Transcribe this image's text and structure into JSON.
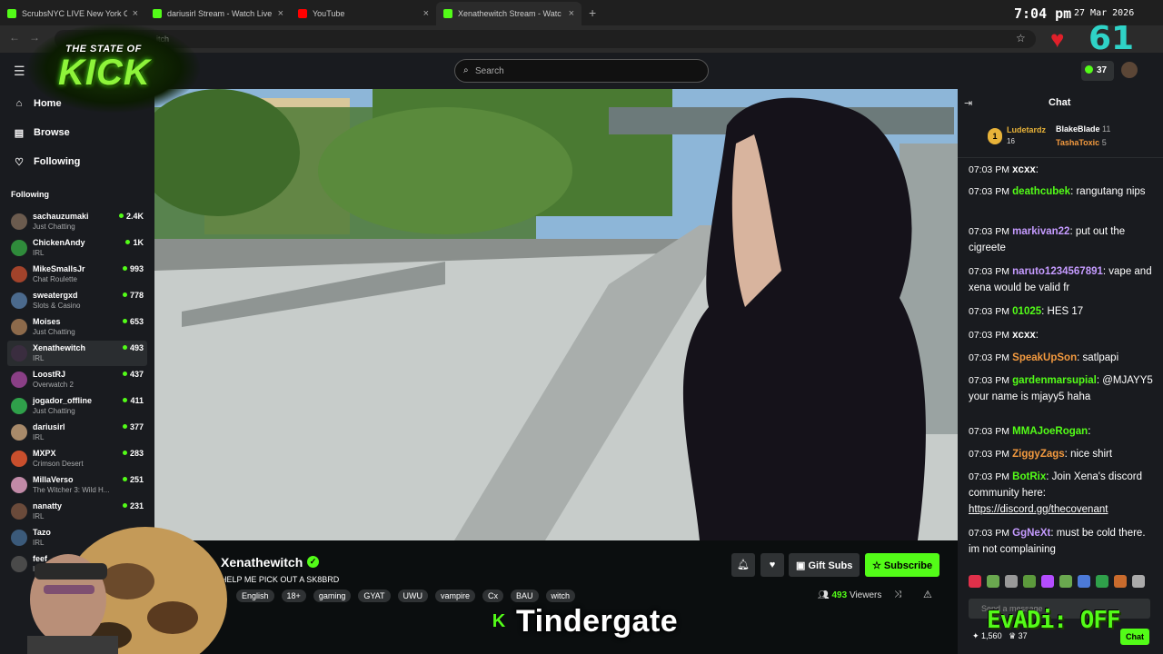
{
  "tabs": [
    {
      "title": "ScrubsNYC LIVE New York C",
      "icon": "kick-icon",
      "color": "#53fc18"
    },
    {
      "title": "dariusirl Stream - Watch Live on",
      "icon": "kick-icon",
      "color": "#53fc18"
    },
    {
      "title": "YouTube",
      "icon": "youtube-icon",
      "color": "#ff0000"
    },
    {
      "title": "Xenathewitch Stream - Watc",
      "icon": "kick-icon",
      "color": "#53fc18"
    }
  ],
  "clock": {
    "time": "7:04 pm",
    "date": "27 Mar 2026"
  },
  "address": {
    "url": "kick.com/xenathewitch",
    "visible": "itch"
  },
  "overlay": {
    "heart_count": "61",
    "tindergate": "Tindergate",
    "evadi": "EvADi: OFF"
  },
  "logo": {
    "line1": "THE STATE OF",
    "line2": "KICK"
  },
  "header": {
    "search_placeholder": "Search",
    "kick_balance": "37"
  },
  "sidebar": {
    "nav": [
      {
        "label": "Home",
        "icon": "home-icon"
      },
      {
        "label": "Browse",
        "icon": "browse-icon"
      },
      {
        "label": "Following",
        "icon": "heart-icon"
      }
    ],
    "following_title": "Following",
    "channels": [
      {
        "name": "sachauzumaki",
        "category": "Just Chatting",
        "viewers": "2.4K",
        "color": "#6b5b4e"
      },
      {
        "name": "ChickenAndy",
        "category": "IRL",
        "viewers": "1K",
        "color": "#2f8b3b"
      },
      {
        "name": "MikeSmallsJr",
        "category": "Chat Roulette",
        "viewers": "993",
        "color": "#a2432b"
      },
      {
        "name": "sweatergxd",
        "category": "Slots & Casino",
        "viewers": "778",
        "color": "#4b6a8d"
      },
      {
        "name": "Moises",
        "category": "Just Chatting",
        "viewers": "653",
        "color": "#8d6a4b"
      },
      {
        "name": "Xenathewitch",
        "category": "IRL",
        "viewers": "493",
        "color": "#3a2d3f"
      },
      {
        "name": "LoostRJ",
        "category": "Overwatch 2",
        "viewers": "437",
        "color": "#8a3f86"
      },
      {
        "name": "jogador_offline",
        "category": "Just Chatting",
        "viewers": "411",
        "color": "#2fa04a"
      },
      {
        "name": "dariusirl",
        "category": "IRL",
        "viewers": "377",
        "color": "#a88a6a"
      },
      {
        "name": "MXPX",
        "category": "Crimson Desert",
        "viewers": "283",
        "color": "#c94f2d"
      },
      {
        "name": "MillaVerso",
        "category": "The Witcher 3: Wild H...",
        "viewers": "251",
        "color": "#c18aa7"
      },
      {
        "name": "nanatty",
        "category": "IRL",
        "viewers": "231",
        "color": "#6a4a3a"
      },
      {
        "name": "Tazo",
        "category": "IRL",
        "viewers": "",
        "color": "#3b5a7a"
      },
      {
        "name": "feef",
        "category": "IRL",
        "viewers": "",
        "color": "#4a4a4a"
      }
    ]
  },
  "stream": {
    "name": "Xenathewitch",
    "title": "HELP ME PICK OUT A SK8BRD",
    "tags": [
      "English",
      "18+",
      "gaming",
      "GYAT",
      "UWU",
      "vampire",
      "Cx",
      "BAU",
      "witch"
    ],
    "viewers": "493",
    "viewers_label": "Viewers",
    "gift_label": "Gift Subs",
    "subscribe_label": "Subscribe"
  },
  "chat": {
    "title": "Chat",
    "leaderboard": [
      {
        "name": "Ludetardz",
        "count": "16",
        "rank": "1"
      },
      {
        "name": "BlakeBlade",
        "count": "11"
      },
      {
        "name": "TashaToxic",
        "count": "5"
      }
    ],
    "messages": [
      {
        "time": "07:03 PM",
        "user": "xcxx",
        "color": "#ffffff",
        "text": ""
      },
      {
        "time": "07:03 PM",
        "user": "deathcubek",
        "color": "#53fc18",
        "text": "rangutang nips"
      },
      {
        "time": "07:03 PM",
        "user": "markivan22",
        "color": "#c59bff",
        "text": "put out the cigreete"
      },
      {
        "time": "07:03 PM",
        "user": "naruto1234567891",
        "color": "#c59bff",
        "text": "vape and xena would be valid fr"
      },
      {
        "time": "07:03 PM",
        "user": "01025",
        "color": "#53fc18",
        "text": "HES 17"
      },
      {
        "time": "07:03 PM",
        "user": "xcxx",
        "color": "#ffffff",
        "text": ""
      },
      {
        "time": "07:03 PM",
        "user": "SpeakUpSon",
        "color": "#f39a3f",
        "text": "satlpapi"
      },
      {
        "time": "07:03 PM",
        "user": "gardenmarsupial",
        "color": "#53fc18",
        "text": "@MJAYY5 your name is mjayy5 haha"
      },
      {
        "time": "07:03 PM",
        "user": "MMAJoeRogan",
        "color": "#53fc18",
        "text": ""
      },
      {
        "time": "07:03 PM",
        "user": "ZiggyZags",
        "color": "#f39a3f",
        "text": "nice shirt"
      },
      {
        "time": "07:03 PM",
        "user": "BotRix",
        "color": "#53fc18",
        "text": "Join Xena's discord community here:",
        "link": "https://discord.gg/thecovenant"
      },
      {
        "time": "07:03 PM",
        "user": "GgNeXt",
        "color": "#c59bff",
        "text": "must be cold there. im not complaining"
      }
    ],
    "input_placeholder": "Send a message",
    "footer_points": "1,560",
    "footer_count": "37",
    "chat_button": "Chat"
  }
}
